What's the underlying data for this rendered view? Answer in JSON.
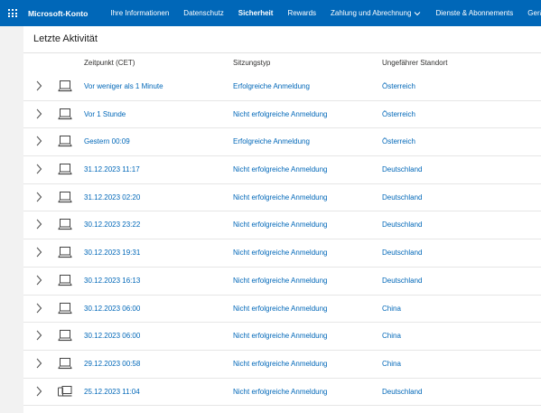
{
  "topbar": {
    "brand": "Microsoft-Konto",
    "nav": [
      {
        "label": "Ihre Informationen"
      },
      {
        "label": "Datenschutz"
      },
      {
        "label": "Sicherheit"
      },
      {
        "label": "Rewards"
      },
      {
        "label": "Zahlung und Abrechnung"
      },
      {
        "label": "Dienste & Abonnements"
      },
      {
        "label": "Geräte"
      }
    ],
    "active": "Sicherheit"
  },
  "panel": {
    "title": "Letzte Aktivität",
    "headers": {
      "time": "Zeitpunkt (CET)",
      "type": "Sitzungstyp",
      "location": "Ungefährer Standort"
    },
    "rows": [
      {
        "time": "Vor weniger als 1 Minute",
        "type": "Erfolgreiche Anmeldung",
        "location": "Österreich",
        "device": "laptop-icon"
      },
      {
        "time": "Vor 1 Stunde",
        "type": "Nicht erfolgreiche Anmeldung",
        "location": "Österreich",
        "device": "laptop-icon"
      },
      {
        "time": "Gestern 00:09",
        "type": "Erfolgreiche Anmeldung",
        "location": "Österreich",
        "device": "laptop-icon"
      },
      {
        "time": "31.12.2023 11:17",
        "type": "Nicht erfolgreiche Anmeldung",
        "location": "Deutschland",
        "device": "laptop-icon"
      },
      {
        "time": "31.12.2023 02:20",
        "type": "Nicht erfolgreiche Anmeldung",
        "location": "Deutschland",
        "device": "laptop-icon"
      },
      {
        "time": "30.12.2023 23:22",
        "type": "Nicht erfolgreiche Anmeldung",
        "location": "Deutschland",
        "device": "laptop-icon"
      },
      {
        "time": "30.12.2023 19:31",
        "type": "Nicht erfolgreiche Anmeldung",
        "location": "Deutschland",
        "device": "laptop-icon"
      },
      {
        "time": "30.12.2023 16:13",
        "type": "Nicht erfolgreiche Anmeldung",
        "location": "Deutschland",
        "device": "laptop-icon"
      },
      {
        "time": "30.12.2023 06:00",
        "type": "Nicht erfolgreiche Anmeldung",
        "location": "China",
        "device": "laptop-icon"
      },
      {
        "time": "30.12.2023 06:00",
        "type": "Nicht erfolgreiche Anmeldung",
        "location": "China",
        "device": "laptop-icon"
      },
      {
        "time": "29.12.2023 00:58",
        "type": "Nicht erfolgreiche Anmeldung",
        "location": "China",
        "device": "laptop-icon"
      },
      {
        "time": "25.12.2023 11:04",
        "type": "Nicht erfolgreiche Anmeldung",
        "location": "Deutschland",
        "device": "devices-icon"
      }
    ]
  },
  "colors": {
    "brand_blue": "#0067b8",
    "link_blue": "#0067b8",
    "page_bg": "#f2f2f2"
  }
}
